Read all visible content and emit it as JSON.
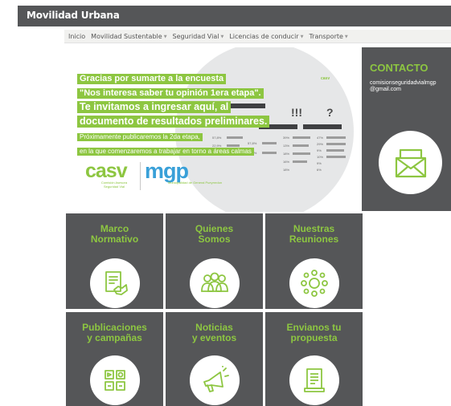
{
  "site": {
    "brand": "Movilidad Urbana"
  },
  "nav": {
    "items": [
      {
        "label": "Inicio",
        "dropdown": false
      },
      {
        "label": "Movilidad Sustentable",
        "dropdown": true
      },
      {
        "label": "Seguridad Vial",
        "dropdown": true
      },
      {
        "label": "Licencias de conducir",
        "dropdown": true
      },
      {
        "label": "Transporte",
        "dropdown": true
      }
    ]
  },
  "banner": {
    "headline": [
      "Gracias por sumarte a la encuesta",
      "\"Nos interesa saber tu opinión 1era etapa\".",
      "Te invitamos a ingresar aquí, al",
      "documento de resultados preliminares."
    ],
    "subtext": [
      "Próximamente publicaremos la 2da etapa,",
      "en la que comenzaremos a trabajar en torno a áreas calmas"
    ],
    "percentages": [
      "57,8%",
      "22,9%",
      "9,5%",
      "57,8%",
      "73,0%",
      "39%",
      "13%",
      "18%",
      "16%",
      "18%",
      "47%",
      "29%",
      "9%",
      "10%",
      "9%",
      "6%"
    ],
    "marks": [
      "!!!",
      "?"
    ],
    "logos": {
      "casv": "casv",
      "casv_sub": "Comisión Asesora Seguridad Vial",
      "mgp": "mgp",
      "mgp_sub": "Municipalidad de General Pueyrredon",
      "mini": "casv"
    }
  },
  "contact": {
    "title": "CONTACTO",
    "email_lines": [
      "comisionseguridadvialmgp",
      "@gmail.com"
    ],
    "icon": "envelope-icon"
  },
  "tiles": [
    {
      "title_lines": [
        "Marco",
        "Normativo"
      ],
      "icon": "document-handshake-icon"
    },
    {
      "title_lines": [
        "Quienes",
        "Somos"
      ],
      "icon": "people-group-icon"
    },
    {
      "title_lines": [
        "Nuestras",
        "Reuniones"
      ],
      "icon": "meeting-circle-icon"
    },
    {
      "title_lines": [
        "Publicaciones",
        "y campañas"
      ],
      "icon": "media-publications-icon"
    },
    {
      "title_lines": [
        "Noticias",
        "y eventos"
      ],
      "icon": "megaphone-icon"
    },
    {
      "title_lines": [
        "Envianos tu",
        "propuesta"
      ],
      "icon": "proposal-document-icon"
    }
  ],
  "colors": {
    "accent_green": "#8dc641",
    "dark_gray": "#555658",
    "brand_blue": "#39a0d8"
  }
}
